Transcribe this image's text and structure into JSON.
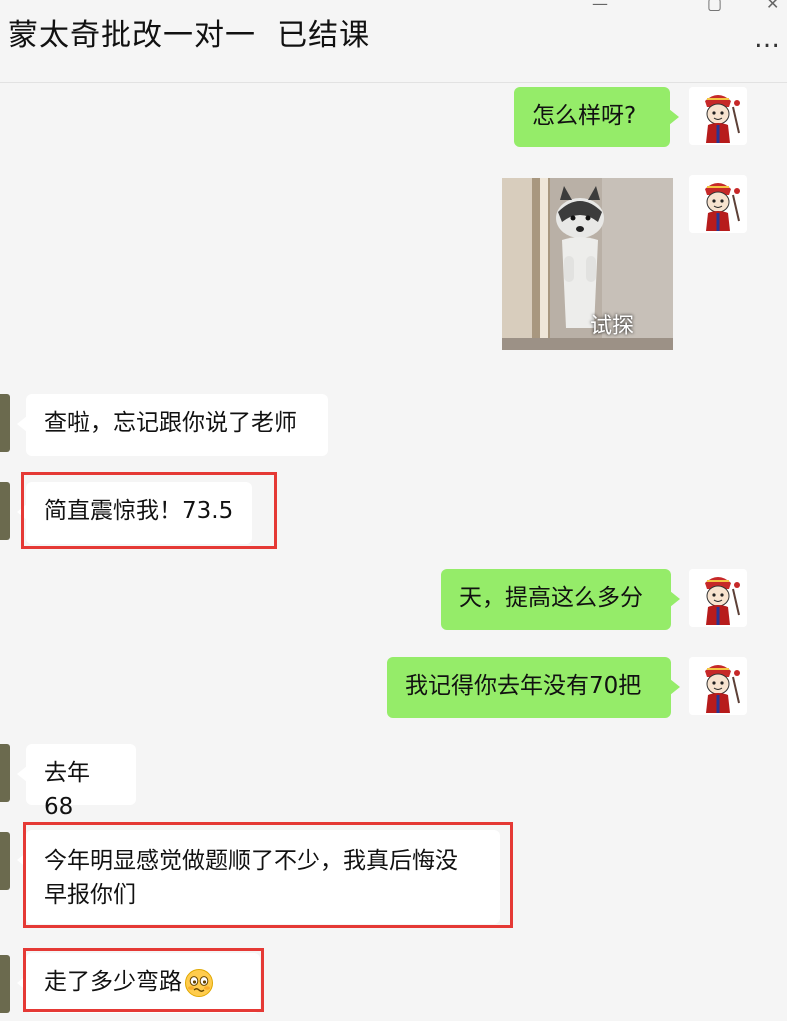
{
  "window": {
    "title": "蒙太奇批改一对一  已结课",
    "more_glyph": "…",
    "controls": {
      "minimize": "—",
      "maximize": "▢",
      "close": "✕"
    }
  },
  "messages": [
    {
      "sender": "me",
      "text": "怎么样呀?"
    },
    {
      "sender": "me",
      "type": "sticker",
      "caption": "试探"
    },
    {
      "sender": "other",
      "text": "查啦，忘记跟你说了老师"
    },
    {
      "sender": "other",
      "text": "简直震惊我！73.5",
      "highlighted": true
    },
    {
      "sender": "me",
      "text": "天，提高这么多分"
    },
    {
      "sender": "me",
      "text": "我记得你去年没有70把"
    },
    {
      "sender": "other",
      "text": "去年68"
    },
    {
      "sender": "other",
      "lines": [
        "今年明显感觉做题顺了不少，我真后悔没",
        "早报你们"
      ],
      "highlighted": true
    },
    {
      "sender": "other",
      "text": "走了多少弯路",
      "emoji": "woozy-face",
      "highlighted": true
    }
  ],
  "colors": {
    "my_bubble": "#95ec69",
    "other_bubble": "#ffffff",
    "highlight": "#e53935",
    "background": "#f5f5f5"
  },
  "icons": {
    "my_avatar": "cartoon-monkey-avatar-icon",
    "sticker": "husky-peeking-sticker",
    "more": "more-options-icon"
  }
}
